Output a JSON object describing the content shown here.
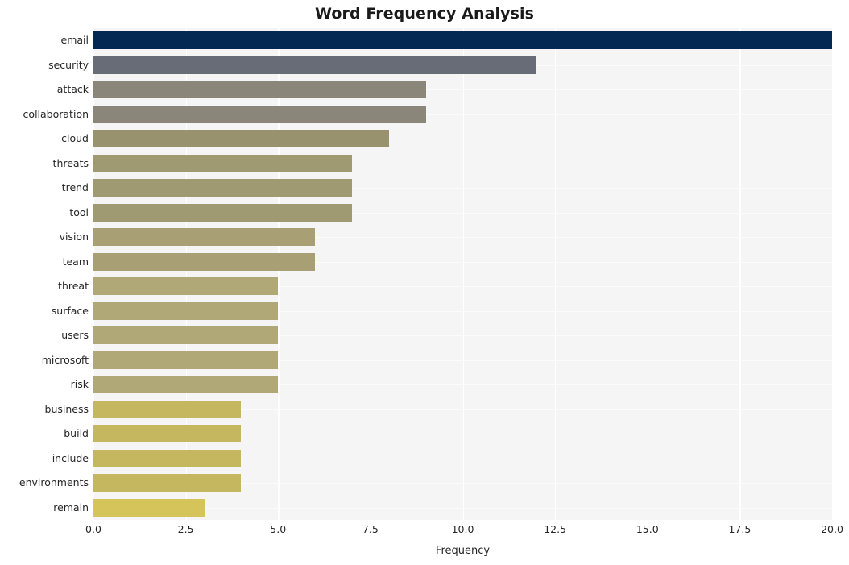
{
  "chart_data": {
    "type": "bar",
    "orientation": "horizontal",
    "title": "Word Frequency Analysis",
    "xlabel": "Frequency",
    "ylabel": "",
    "xlim": [
      0,
      20
    ],
    "xticks": [
      "0.0",
      "2.5",
      "5.0",
      "7.5",
      "10.0",
      "12.5",
      "15.0",
      "17.5",
      "20.0"
    ],
    "xtick_values": [
      0,
      2.5,
      5,
      7.5,
      10,
      12.5,
      15,
      17.5,
      20
    ],
    "grid": "vertical-white-on-gray",
    "legend": "none",
    "categories": [
      "email",
      "security",
      "attack",
      "collaboration",
      "cloud",
      "threats",
      "trend",
      "tool",
      "vision",
      "team",
      "threat",
      "surface",
      "users",
      "microsoft",
      "risk",
      "business",
      "build",
      "include",
      "environments",
      "remain"
    ],
    "values": [
      20,
      12,
      9,
      9,
      8,
      7,
      7,
      7,
      6,
      6,
      5,
      5,
      5,
      5,
      5,
      4,
      4,
      4,
      4,
      3
    ],
    "bar_colors": [
      "#042a54",
      "#686c76",
      "#8a877a",
      "#8a877a",
      "#98926f",
      "#a09a72",
      "#a09a72",
      "#a09a72",
      "#a8a074",
      "#a8a074",
      "#b0a876",
      "#b0a876",
      "#b0a876",
      "#b0a876",
      "#b0a876",
      "#c4b75f",
      "#c4b75f",
      "#c4b75f",
      "#c4b75f",
      "#d4c45a"
    ],
    "plot_background": "#f5f5f6",
    "figure_background": "#ffffff",
    "gridline_color": "#ffffff",
    "text_color": "#262626",
    "title_color": "#1a1a1a"
  }
}
